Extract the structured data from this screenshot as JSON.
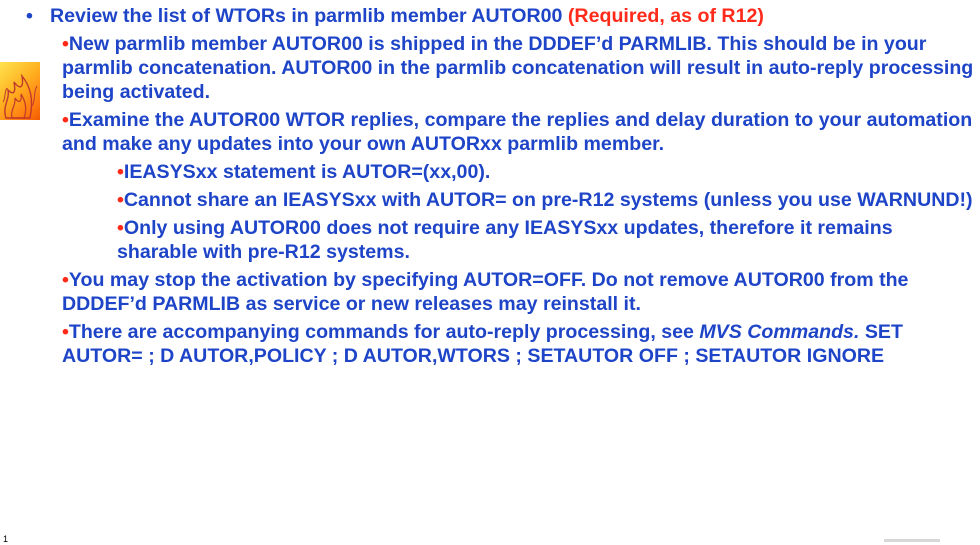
{
  "main_bullet": {
    "text": "Review the list of WTORs in parmlib member AUTOR00 ",
    "required": "(Required, as of R12)"
  },
  "items": [
    {
      "level": 1,
      "text": "New parmlib member AUTOR00 is shipped in the DDDEF’d PARMLIB. This should be in your parmlib concatenation. AUTOR00 in the parmlib concatenation will result in auto-reply processing being activated."
    },
    {
      "level": 1,
      "text": "Examine the AUTOR00 WTOR replies, compare the replies and delay duration to your automation and make any updates into your own AUTORxx parmlib member."
    },
    {
      "level": 2,
      "text": "IEASYSxx statement is AUTOR=(xx,00)."
    },
    {
      "level": 2,
      "text": "Cannot share an IEASYSxx with AUTOR= on pre-R12 systems (unless you use WARNUND!)"
    },
    {
      "level": 2,
      "text": "Only using AUTOR00 does not require any IEASYSxx updates, therefore it remains sharable with pre-R12 systems."
    },
    {
      "level": 1,
      "text": "You may stop the activation by specifying AUTOR=OFF.  Do not remove AUTOR00 from the DDDEF’d PARMLIB as service or new releases may reinstall it."
    }
  ],
  "last_item": {
    "text_a": "There are accompanying commands for auto-reply processing, see ",
    "italic": "MVS Commands.",
    "text_b": "  SET AUTOR= ; D AUTOR,POLICY ; D AUTOR,WTORS ; SETAUTOR OFF ; SETAUTOR IGNORE"
  },
  "bullet_char": "•",
  "page_number": "1",
  "colors": {
    "text": "#1e44c8",
    "accent": "#ff2a1a"
  }
}
